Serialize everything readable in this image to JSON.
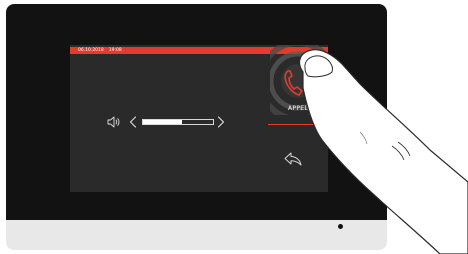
{
  "status_bar": {
    "date": "06.10.2018",
    "time": "19:08",
    "color": "#e53b2d"
  },
  "volume": {
    "level": 0.55,
    "speaker_icon": "speaker-icon",
    "decrease_icon": "chevron-left-icon",
    "increase_icon": "chevron-right-icon"
  },
  "call": {
    "label": "APPEL",
    "icon": "phone-icon",
    "color": "#e53b2d"
  },
  "back": {
    "icon": "back-arrow-icon"
  }
}
